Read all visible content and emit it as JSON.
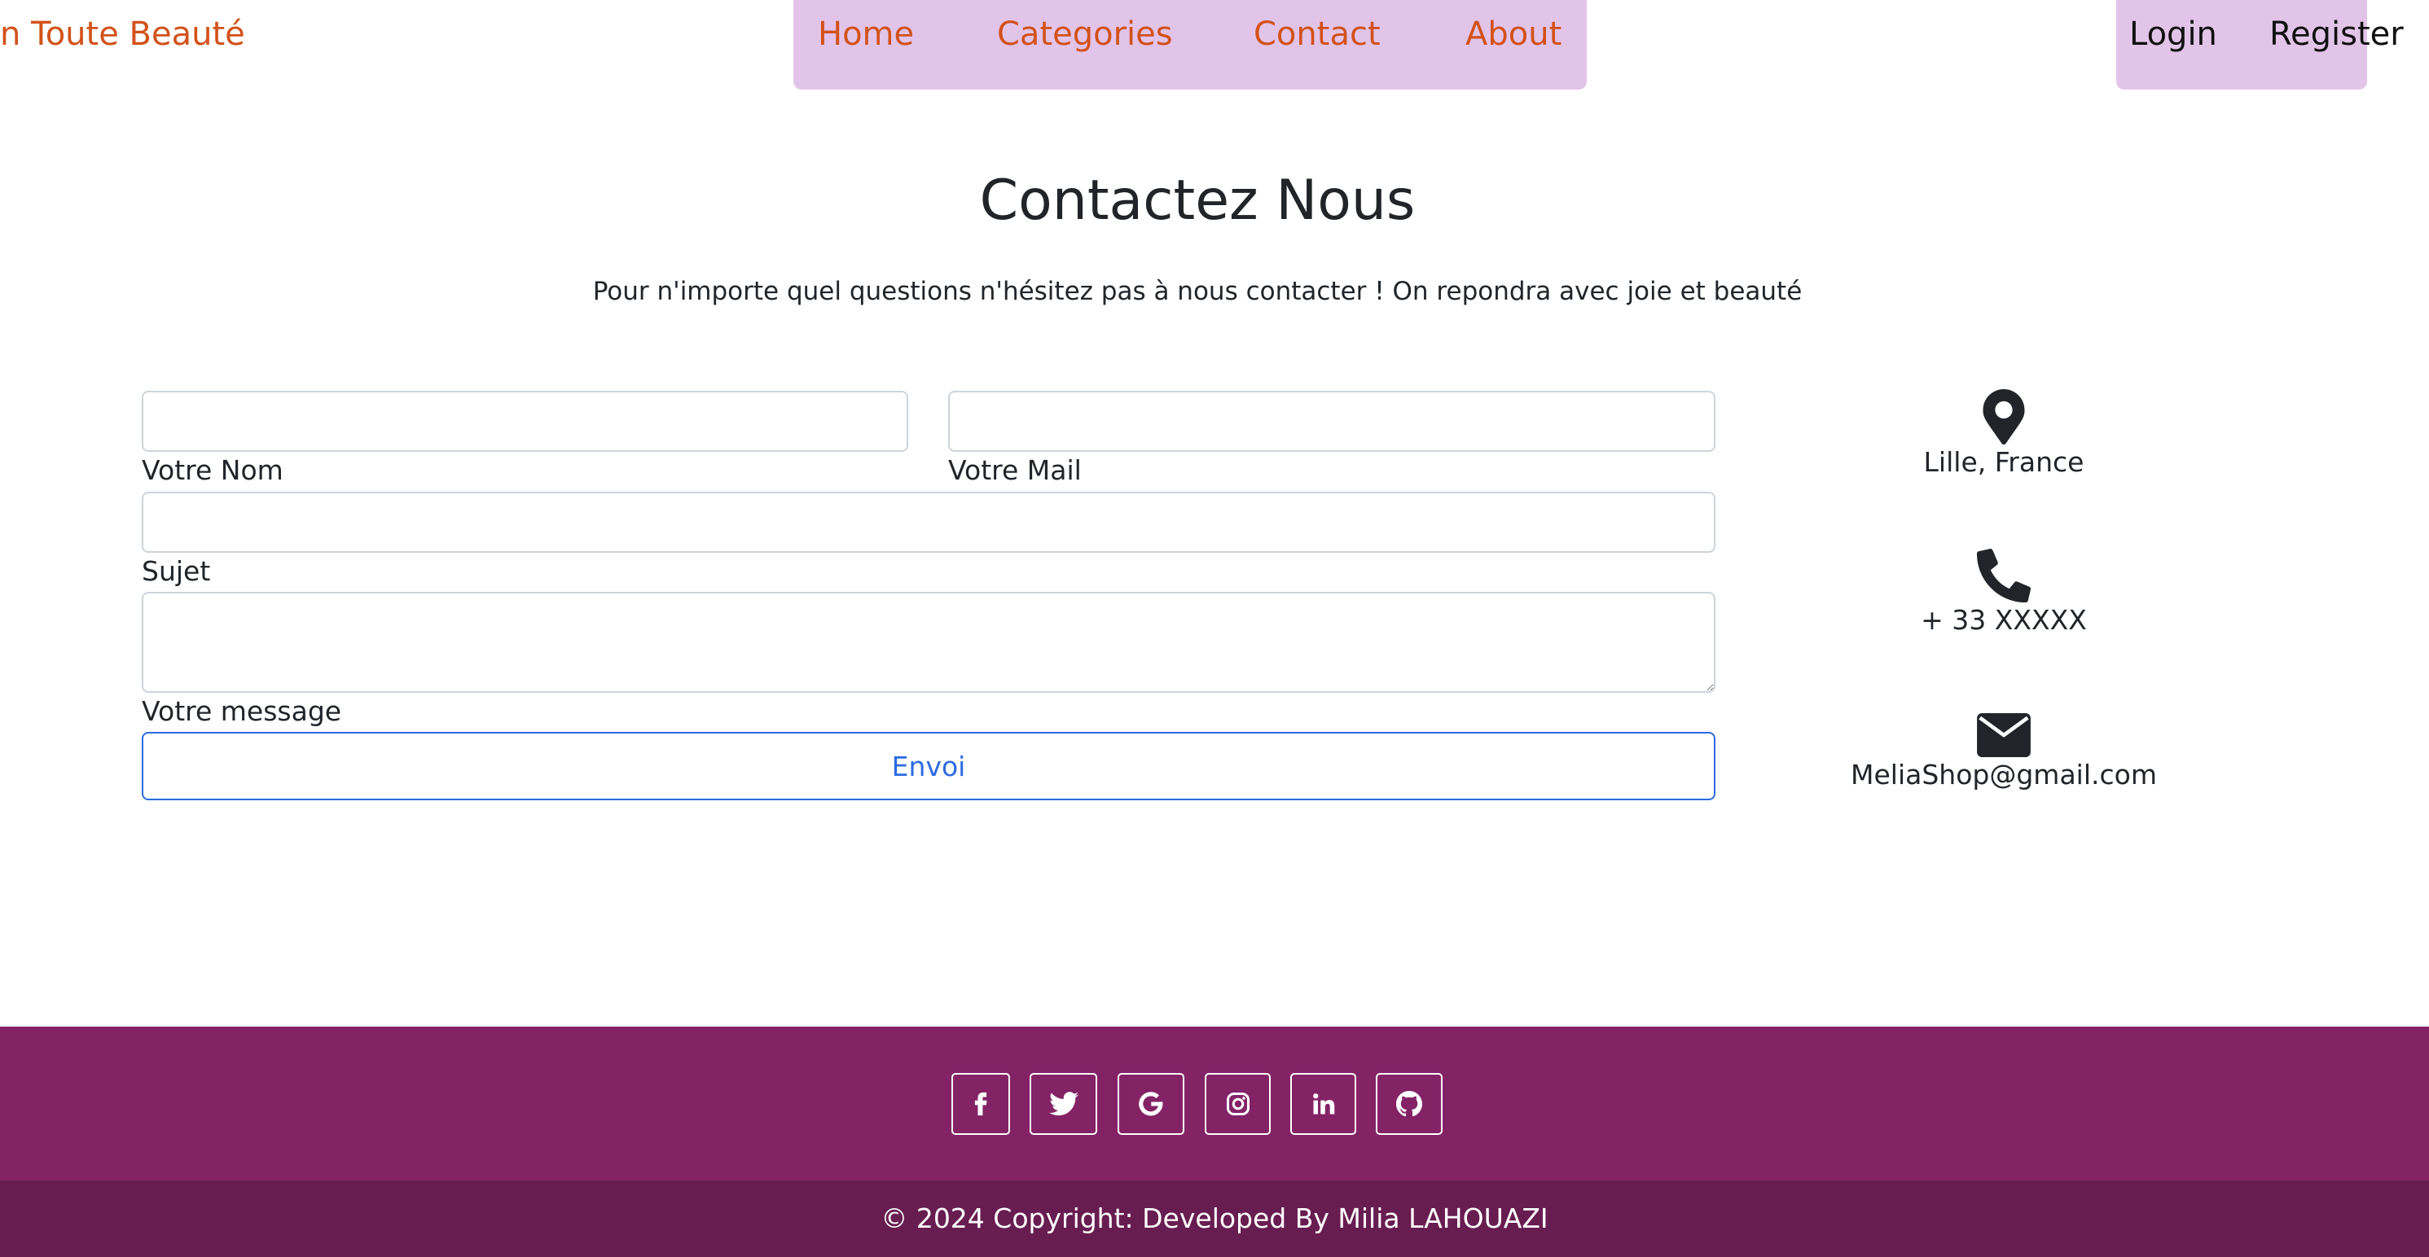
{
  "brand": {
    "name": "n Toute Beauté"
  },
  "nav": {
    "links": [
      {
        "label": "Home"
      },
      {
        "label": "Categories"
      },
      {
        "label": "Contact"
      },
      {
        "label": "About"
      }
    ],
    "auth": [
      {
        "label": "Login"
      },
      {
        "label": "Register"
      }
    ]
  },
  "colors": {
    "accent": "#d2521a",
    "nav_background": "#e3c4e9",
    "footer_background": "#832366",
    "copyright_background": "#681d51",
    "button_blue": "#2b6be2"
  },
  "contact": {
    "title": "Contactez Nous",
    "subtitle": "Pour n'importe quel questions n'hésitez pas à nous contacter ! On repondra avec joie et beauté",
    "form": {
      "name_label": "Votre Nom",
      "name_value": "",
      "email_label": "Votre Mail",
      "email_value": "",
      "subject_label": "Sujet",
      "subject_value": "",
      "message_label": "Votre message",
      "message_value": "",
      "submit_label": "Envoi"
    },
    "info": [
      {
        "icon": "map-marker-icon",
        "text": "Lille, France"
      },
      {
        "icon": "phone-icon",
        "text": "+ 33 XXXXX"
      },
      {
        "icon": "envelope-icon",
        "text": "MeliaShop@gmail.com"
      }
    ]
  },
  "footer": {
    "social": [
      {
        "icon": "facebook-icon"
      },
      {
        "icon": "twitter-icon"
      },
      {
        "icon": "google-icon"
      },
      {
        "icon": "instagram-icon"
      },
      {
        "icon": "linkedin-icon"
      },
      {
        "icon": "github-icon"
      }
    ],
    "copyright": "© 2024 Copyright: Developed By Milia LAHOUAZI"
  }
}
